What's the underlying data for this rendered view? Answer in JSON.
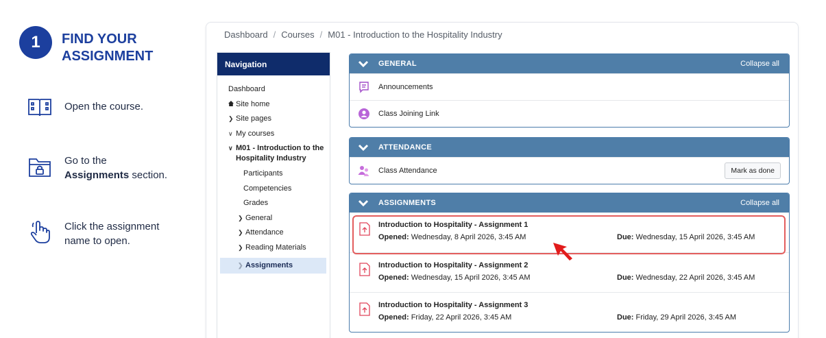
{
  "step": {
    "number": "1",
    "title": "FIND YOUR ASSIGNMENT",
    "instructions": [
      {
        "icon": "open-book-icon",
        "text": "Open the course."
      },
      {
        "icon": "folder-lock-icon",
        "prefix": "Go to the",
        "bold": "Assignments",
        "suffix": "section."
      },
      {
        "icon": "pointer-hand-icon",
        "text": "Click the assignment name to open."
      }
    ]
  },
  "breadcrumb": [
    "Dashboard",
    "Courses",
    "M01 - Introduction to the Hospitality Industry"
  ],
  "navigation": {
    "title": "Navigation",
    "items": [
      {
        "label": "Dashboard",
        "glyph": ""
      },
      {
        "label": "Site home",
        "glyph": "home"
      },
      {
        "label": "Site pages",
        "glyph": ">"
      },
      {
        "label": "My courses",
        "glyph": "v"
      },
      {
        "label": "M01 - Introduction to the Hospitality Industry",
        "glyph": "v"
      },
      {
        "label": "Participants"
      },
      {
        "label": "Competencies"
      },
      {
        "label": "Grades"
      },
      {
        "label": "General",
        "glyph": ">"
      },
      {
        "label": "Attendance",
        "glyph": ">"
      },
      {
        "label": "Reading Materials",
        "glyph": ">"
      },
      {
        "label": "Assignments",
        "glyph": ">"
      }
    ]
  },
  "sections": {
    "general": {
      "title": "GENERAL",
      "collapse": "Collapse all",
      "items": [
        "Announcements",
        "Class Joining Link"
      ]
    },
    "attendance": {
      "title": "ATTENDANCE",
      "item": "Class Attendance",
      "button": "Mark as done"
    },
    "assignments": {
      "title": "ASSIGNMENTS",
      "collapse": "Collapse all",
      "opened_label": "Opened:",
      "due_label": "Due:",
      "items": [
        {
          "name": "Introduction to Hospitality - Assignment 1",
          "opened": "Wednesday, 8 April 2026, 3:45 AM",
          "due": "Wednesday, 15 April 2026, 3:45 AM"
        },
        {
          "name": "Introduction to Hospitality - Assignment 2",
          "opened": "Wednesday, 15 April 2026, 3:45 AM",
          "due": "Wednesday, 22 April 2026, 3:45 AM"
        },
        {
          "name": "Introduction to Hospitality - Assignment 3",
          "opened": "Friday, 22 April 2026, 3:45 AM",
          "due": "Friday, 29 April 2026, 3:45 AM"
        }
      ]
    }
  },
  "colors": {
    "brand_blue": "#1c3f9e",
    "nav_header": "#0f2c6b",
    "section_header": "#4f7ea8",
    "highlight_red": "#e35d5d"
  }
}
